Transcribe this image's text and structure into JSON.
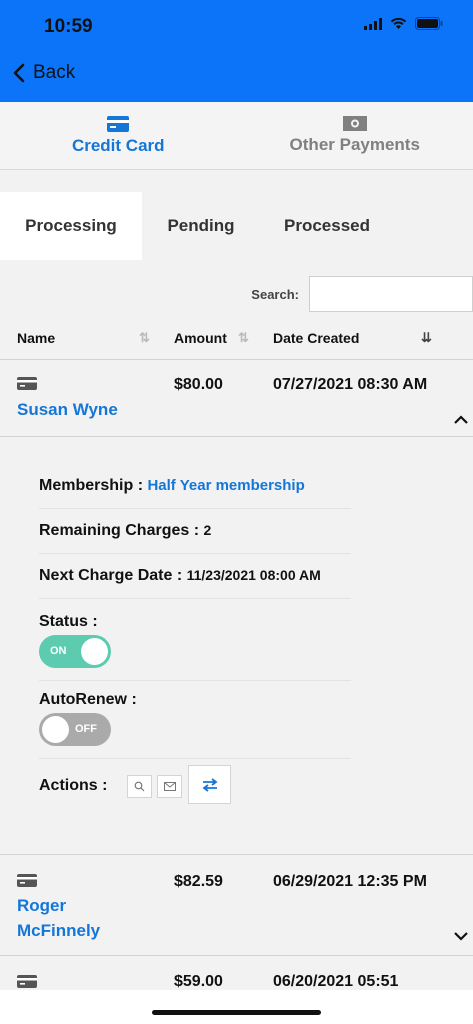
{
  "status_bar": {
    "time": "10:59"
  },
  "nav": {
    "back_label": "Back"
  },
  "payment_tabs": [
    {
      "label": "Credit Card",
      "icon": "credit-card-icon"
    },
    {
      "label": "Other Payments",
      "icon": "cash-icon"
    }
  ],
  "status_tabs": [
    "Processing",
    "Pending",
    "Processed"
  ],
  "search": {
    "label": "Search:",
    "placeholder": ""
  },
  "table": {
    "columns": [
      "Name",
      "Amount",
      "Date Created"
    ],
    "rows": [
      {
        "name": "Susan Wyne",
        "amount": "$80.00",
        "date": "07/27/2021 08:30 AM"
      },
      {
        "name_line1": "Roger",
        "name_line2": "McFinnely",
        "amount": "$82.59",
        "date": "06/29/2021 12:35 PM"
      },
      {
        "amount": "$59.00",
        "date": "06/20/2021 05:51"
      }
    ]
  },
  "details": {
    "membership_label": "Membership :",
    "membership_value": "Half Year membership",
    "remaining_label": "Remaining Charges :",
    "remaining_value": "2",
    "next_charge_label": "Next Charge Date :",
    "next_charge_value": "11/23/2021 08:00 AM",
    "status_label": "Status :",
    "status_toggle": "ON",
    "autorenew_label": "AutoRenew :",
    "autorenew_toggle": "OFF",
    "actions_label": "Actions :"
  },
  "colors": {
    "nav_bg": "#0b74f8",
    "accent": "#1477d8",
    "toggle_on": "#5ccbb0",
    "toggle_off": "#aaaaaa"
  }
}
